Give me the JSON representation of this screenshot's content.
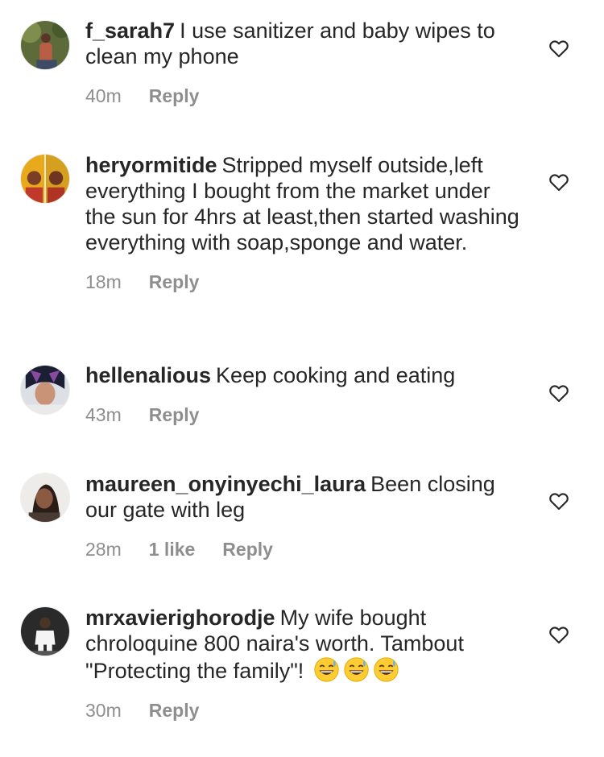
{
  "comments": [
    {
      "username": "f_sarah7",
      "text": "I use sanitizer and baby wipes to clean my phone",
      "time": "40m",
      "likes": "",
      "reply": "Reply",
      "avatar_colors": [
        "#6b7a3f",
        "#a8503f"
      ]
    },
    {
      "username": "heryormitide",
      "text": "Stripped myself outside,left everything I bought from the market under the sun for 4hrs at least,then started washing everything with soap,sponge and water.",
      "time": "18m",
      "likes": "",
      "reply": "Reply",
      "avatar_colors": [
        "#e0b12a",
        "#c0392b"
      ]
    },
    {
      "username": "hellenalious",
      "text": "Keep cooking and eating",
      "time": "43m",
      "likes": "",
      "reply": "Reply",
      "avatar_colors": [
        "#1a2a4a",
        "#d8b4d4"
      ]
    },
    {
      "username": "maureen_onyinyechi_laura",
      "text": "Been closing our gate with leg",
      "time": "28m",
      "likes": "1 like",
      "reply": "Reply",
      "avatar_colors": [
        "#e9e6e2",
        "#2b1d18"
      ]
    },
    {
      "username": "mrxavierighorodje",
      "text": "My wife bought chroloquine 800 naira's worth. Tambout \"Protecting the family\"!",
      "emoji": [
        "grinning-sweat",
        "grinning-sweat",
        "grinning-sweat"
      ],
      "time": "30m",
      "likes": "",
      "reply": "Reply",
      "avatar_colors": [
        "#2e2e2e",
        "#f2f2f2"
      ]
    }
  ],
  "icons": {
    "like": "heart-outline-icon",
    "emoji": "grinning-face-with-sweat"
  },
  "colors": {
    "text": "#262626",
    "meta": "#8e8e8e",
    "background": "#ffffff"
  }
}
